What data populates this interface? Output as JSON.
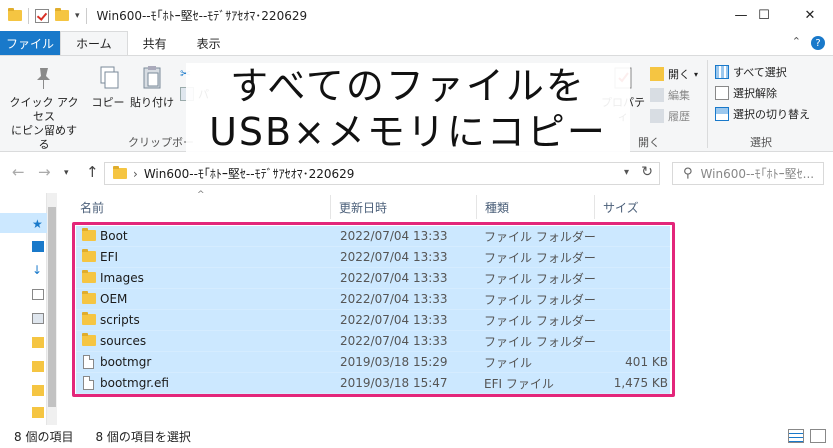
{
  "window": {
    "title": "Win600--ﾓ｢ﾎﾄｰ堅ｾ--ﾓﾃﾞｻｱｾｵﾏ･220629",
    "minimize_glyph": "—",
    "maximize_glyph": "☐",
    "close_glyph": "✕"
  },
  "tabs": {
    "file": "ファイル",
    "home": "ホーム",
    "share": "共有",
    "view": "表示",
    "help": "?"
  },
  "ribbon": {
    "pin_label_1": "クイック アクセス",
    "pin_label_2": "にピン留めする",
    "copy": "コピー",
    "paste": "貼り付け",
    "cut_partial": "パ",
    "clipboard_group": "クリップボー",
    "properties": "プロパティ",
    "open": "開く",
    "edit": "編集",
    "history": "履歴",
    "open_group": "開く",
    "select_all": "すべて選択",
    "select_none": "選択解除",
    "invert_selection": "選択の切り替え",
    "select_group": "選択"
  },
  "caption": {
    "line1": "すべてのファイルを",
    "line2": "USB×メモリにコピー"
  },
  "address": {
    "path": "Win600--ﾓ｢ﾎﾄｰ堅ｾ--ﾓﾃﾞｻｱｾｵﾏ･220629",
    "search_placeholder": "Win600--ﾓ｢ﾎﾄｰ堅ｾ..."
  },
  "columns": {
    "name": "名前",
    "modified": "更新日時",
    "type": "種類",
    "size": "サイズ"
  },
  "files": [
    {
      "name": "Boot",
      "date": "2022/07/04 13:33",
      "type": "ファイル フォルダー",
      "size": "",
      "kind": "folder"
    },
    {
      "name": "EFI",
      "date": "2022/07/04 13:33",
      "type": "ファイル フォルダー",
      "size": "",
      "kind": "folder"
    },
    {
      "name": "Images",
      "date": "2022/07/04 13:33",
      "type": "ファイル フォルダー",
      "size": "",
      "kind": "folder"
    },
    {
      "name": "OEM",
      "date": "2022/07/04 13:33",
      "type": "ファイル フォルダー",
      "size": "",
      "kind": "folder"
    },
    {
      "name": "scripts",
      "date": "2022/07/04 13:33",
      "type": "ファイル フォルダー",
      "size": "",
      "kind": "folder"
    },
    {
      "name": "sources",
      "date": "2022/07/04 13:33",
      "type": "ファイル フォルダー",
      "size": "",
      "kind": "folder"
    },
    {
      "name": "bootmgr",
      "date": "2019/03/18 15:29",
      "type": "ファイル",
      "size": "401 KB",
      "kind": "file"
    },
    {
      "name": "bootmgr.efi",
      "date": "2019/03/18 15:47",
      "type": "EFI ファイル",
      "size": "1,475 KB",
      "kind": "file"
    }
  ],
  "status": {
    "item_count": "8 個の項目",
    "selected_count": "8 個の項目を選択"
  },
  "colors": {
    "accent": "#1979ca",
    "selection": "#cce8ff",
    "highlight_border": "#e3267a",
    "folder": "#f5c542"
  }
}
